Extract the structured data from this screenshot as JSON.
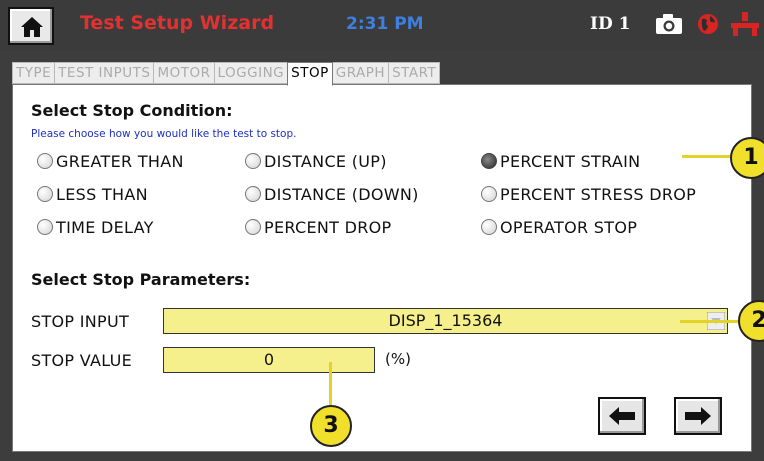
{
  "header": {
    "title": "Test Setup Wizard",
    "time": "2:31 PM",
    "device_id": "ID 1",
    "icons": [
      "home-icon",
      "camera-icon",
      "globe-icon",
      "plug-icon"
    ],
    "colors": {
      "title": "#e23131",
      "time": "#3f7fe0"
    }
  },
  "tabs": [
    {
      "label": "TYPE",
      "active": false
    },
    {
      "label": "TEST INPUTS",
      "active": false
    },
    {
      "label": "MOTOR",
      "active": false
    },
    {
      "label": "LOGGING",
      "active": false
    },
    {
      "label": "STOP",
      "active": true
    },
    {
      "label": "GRAPH",
      "active": false
    },
    {
      "label": "START",
      "active": false
    }
  ],
  "stop_condition": {
    "heading": "Select Stop Condition:",
    "hint": "Please choose how you would like the test to stop.",
    "options": [
      {
        "label": "GREATER THAN",
        "checked": false
      },
      {
        "label": "DISTANCE (UP)",
        "checked": false
      },
      {
        "label": "PERCENT STRAIN",
        "checked": true
      },
      {
        "label": "LESS THAN",
        "checked": false
      },
      {
        "label": "DISTANCE (DOWN)",
        "checked": false
      },
      {
        "label": "PERCENT STRESS DROP",
        "checked": false
      },
      {
        "label": "TIME DELAY",
        "checked": false
      },
      {
        "label": "PERCENT DROP",
        "checked": false
      },
      {
        "label": "OPERATOR STOP",
        "checked": false
      }
    ]
  },
  "stop_params": {
    "heading": "Select Stop Parameters:",
    "stop_input": {
      "label": "STOP INPUT",
      "value": "DISP_1_15364"
    },
    "stop_value": {
      "label": "STOP VALUE",
      "value": "0",
      "unit": "(%)"
    }
  },
  "nav": {
    "back_icon": "arrow-left-icon",
    "next_icon": "arrow-right-icon"
  },
  "callouts": [
    "1",
    "2",
    "3"
  ],
  "colors": {
    "field_bg": "#f5f08c",
    "callout": "#f1e02b"
  }
}
